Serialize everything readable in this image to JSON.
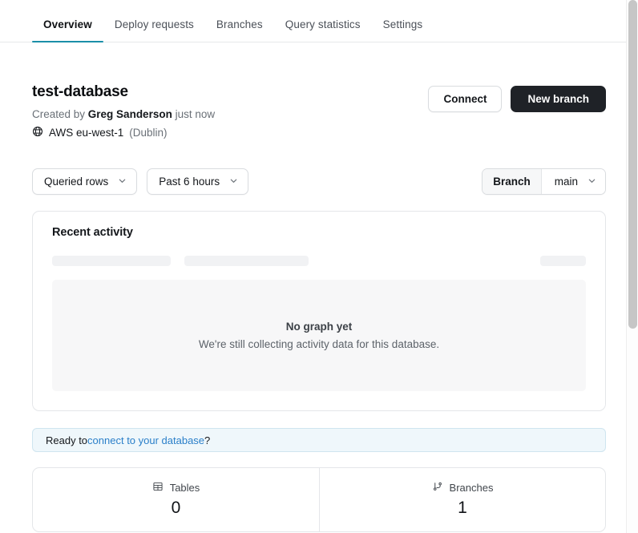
{
  "tabs": [
    {
      "label": "Overview",
      "active": true
    },
    {
      "label": "Deploy requests",
      "active": false
    },
    {
      "label": "Branches",
      "active": false
    },
    {
      "label": "Query statistics",
      "active": false
    },
    {
      "label": "Settings",
      "active": false
    }
  ],
  "database": {
    "name": "test-database",
    "created_prefix": "Created by ",
    "created_by": "Greg Sanderson",
    "created_suffix": " just now",
    "region_icon": "globe-icon",
    "region": "AWS eu-west-1",
    "region_city": "(Dublin)"
  },
  "header_actions": {
    "connect_label": "Connect",
    "new_branch_label": "New branch"
  },
  "filters": {
    "metric": {
      "label": "Queried rows",
      "icon": "chevron-down-icon"
    },
    "timerange": {
      "label": "Past 6 hours",
      "icon": "chevron-down-icon"
    },
    "branch": {
      "label": "Branch",
      "value": "main",
      "icon": "chevron-down-icon"
    }
  },
  "activity_card": {
    "title": "Recent activity",
    "empty_title": "No graph yet",
    "empty_subtitle": "We're still collecting activity data for this database."
  },
  "banner": {
    "prefix": "Ready to ",
    "link": "connect to your database",
    "suffix": "?"
  },
  "stats": [
    {
      "icon": "table-icon",
      "label": "Tables",
      "value": "0"
    },
    {
      "icon": "git-branch-icon",
      "label": "Branches",
      "value": "1"
    }
  ],
  "colors": {
    "accent": "#1b8fa8",
    "primary_button": "#1f2227",
    "link": "#2a7fc9",
    "banner_bg": "#eff7fb",
    "banner_border": "#cfe5ef"
  }
}
